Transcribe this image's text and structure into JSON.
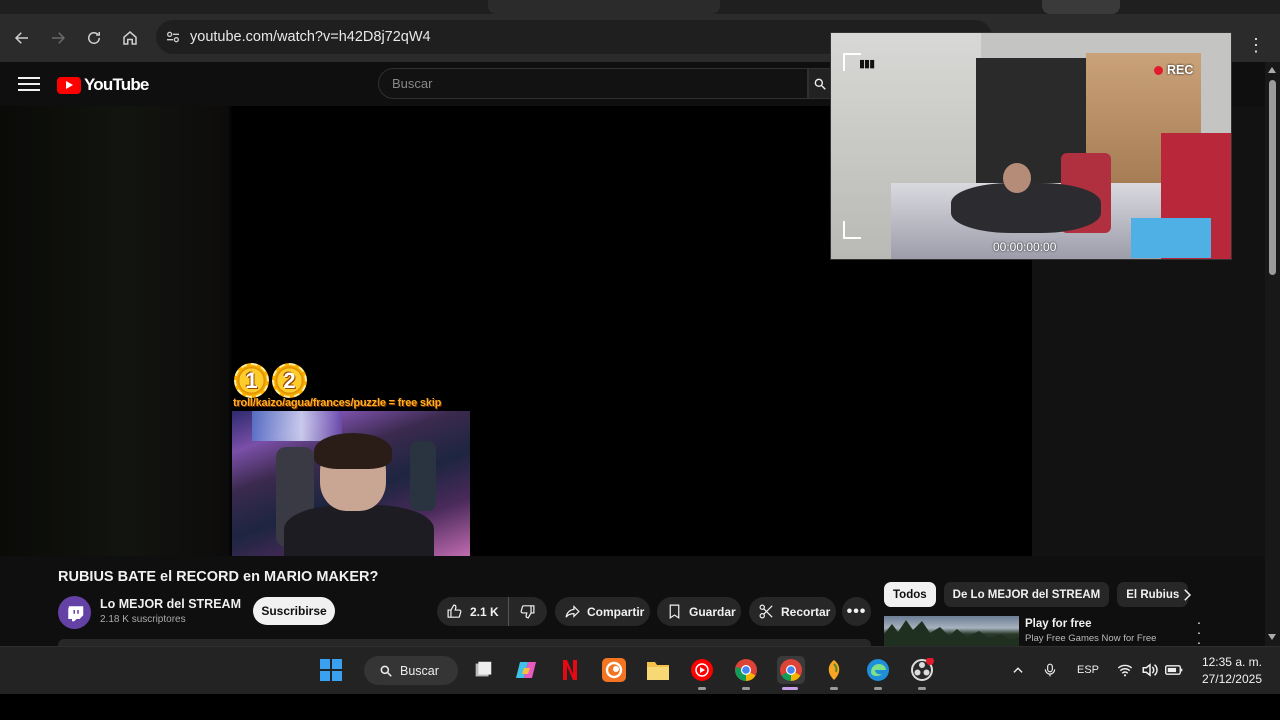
{
  "browser": {
    "url": "youtube.com/watch?v=h42D8j72qW4"
  },
  "youtube": {
    "logo_text": "YouTube",
    "search_placeholder": "Buscar"
  },
  "player": {
    "overlay_medals": [
      "1",
      "2"
    ],
    "overlay_text": "troll/kaizo/agua/frances/puzzle = free skip"
  },
  "pip": {
    "rec_label": "REC",
    "battery_text": "▮▮▮",
    "timecode": "00:00:00:00"
  },
  "video": {
    "title": "RUBIUS BATE el RECORD en MARIO MAKER?",
    "channel_name": "Lo MEJOR del STREAM",
    "channel_subs": "2.18 K suscriptores",
    "subscribe_label": "Suscribirse",
    "like_count": "2.1 K",
    "share_label": "Compartir",
    "save_label": "Guardar",
    "clip_label": "Recortar",
    "more_label": "•••"
  },
  "sidebar": {
    "chips": [
      "Todos",
      "De Lo MEJOR del STREAM",
      "El Rubius"
    ],
    "ad": {
      "title": "Play for free",
      "subtitle": "Play Free Games Now for Free"
    }
  },
  "taskbar": {
    "search_label": "Buscar",
    "language": "ESP",
    "time": "12:35 a. m.",
    "date": "27/12/2025"
  },
  "colors": {
    "yt_red": "#ff0000",
    "twitch_purple": "#6441a5",
    "rec_red": "#e21b2c"
  }
}
